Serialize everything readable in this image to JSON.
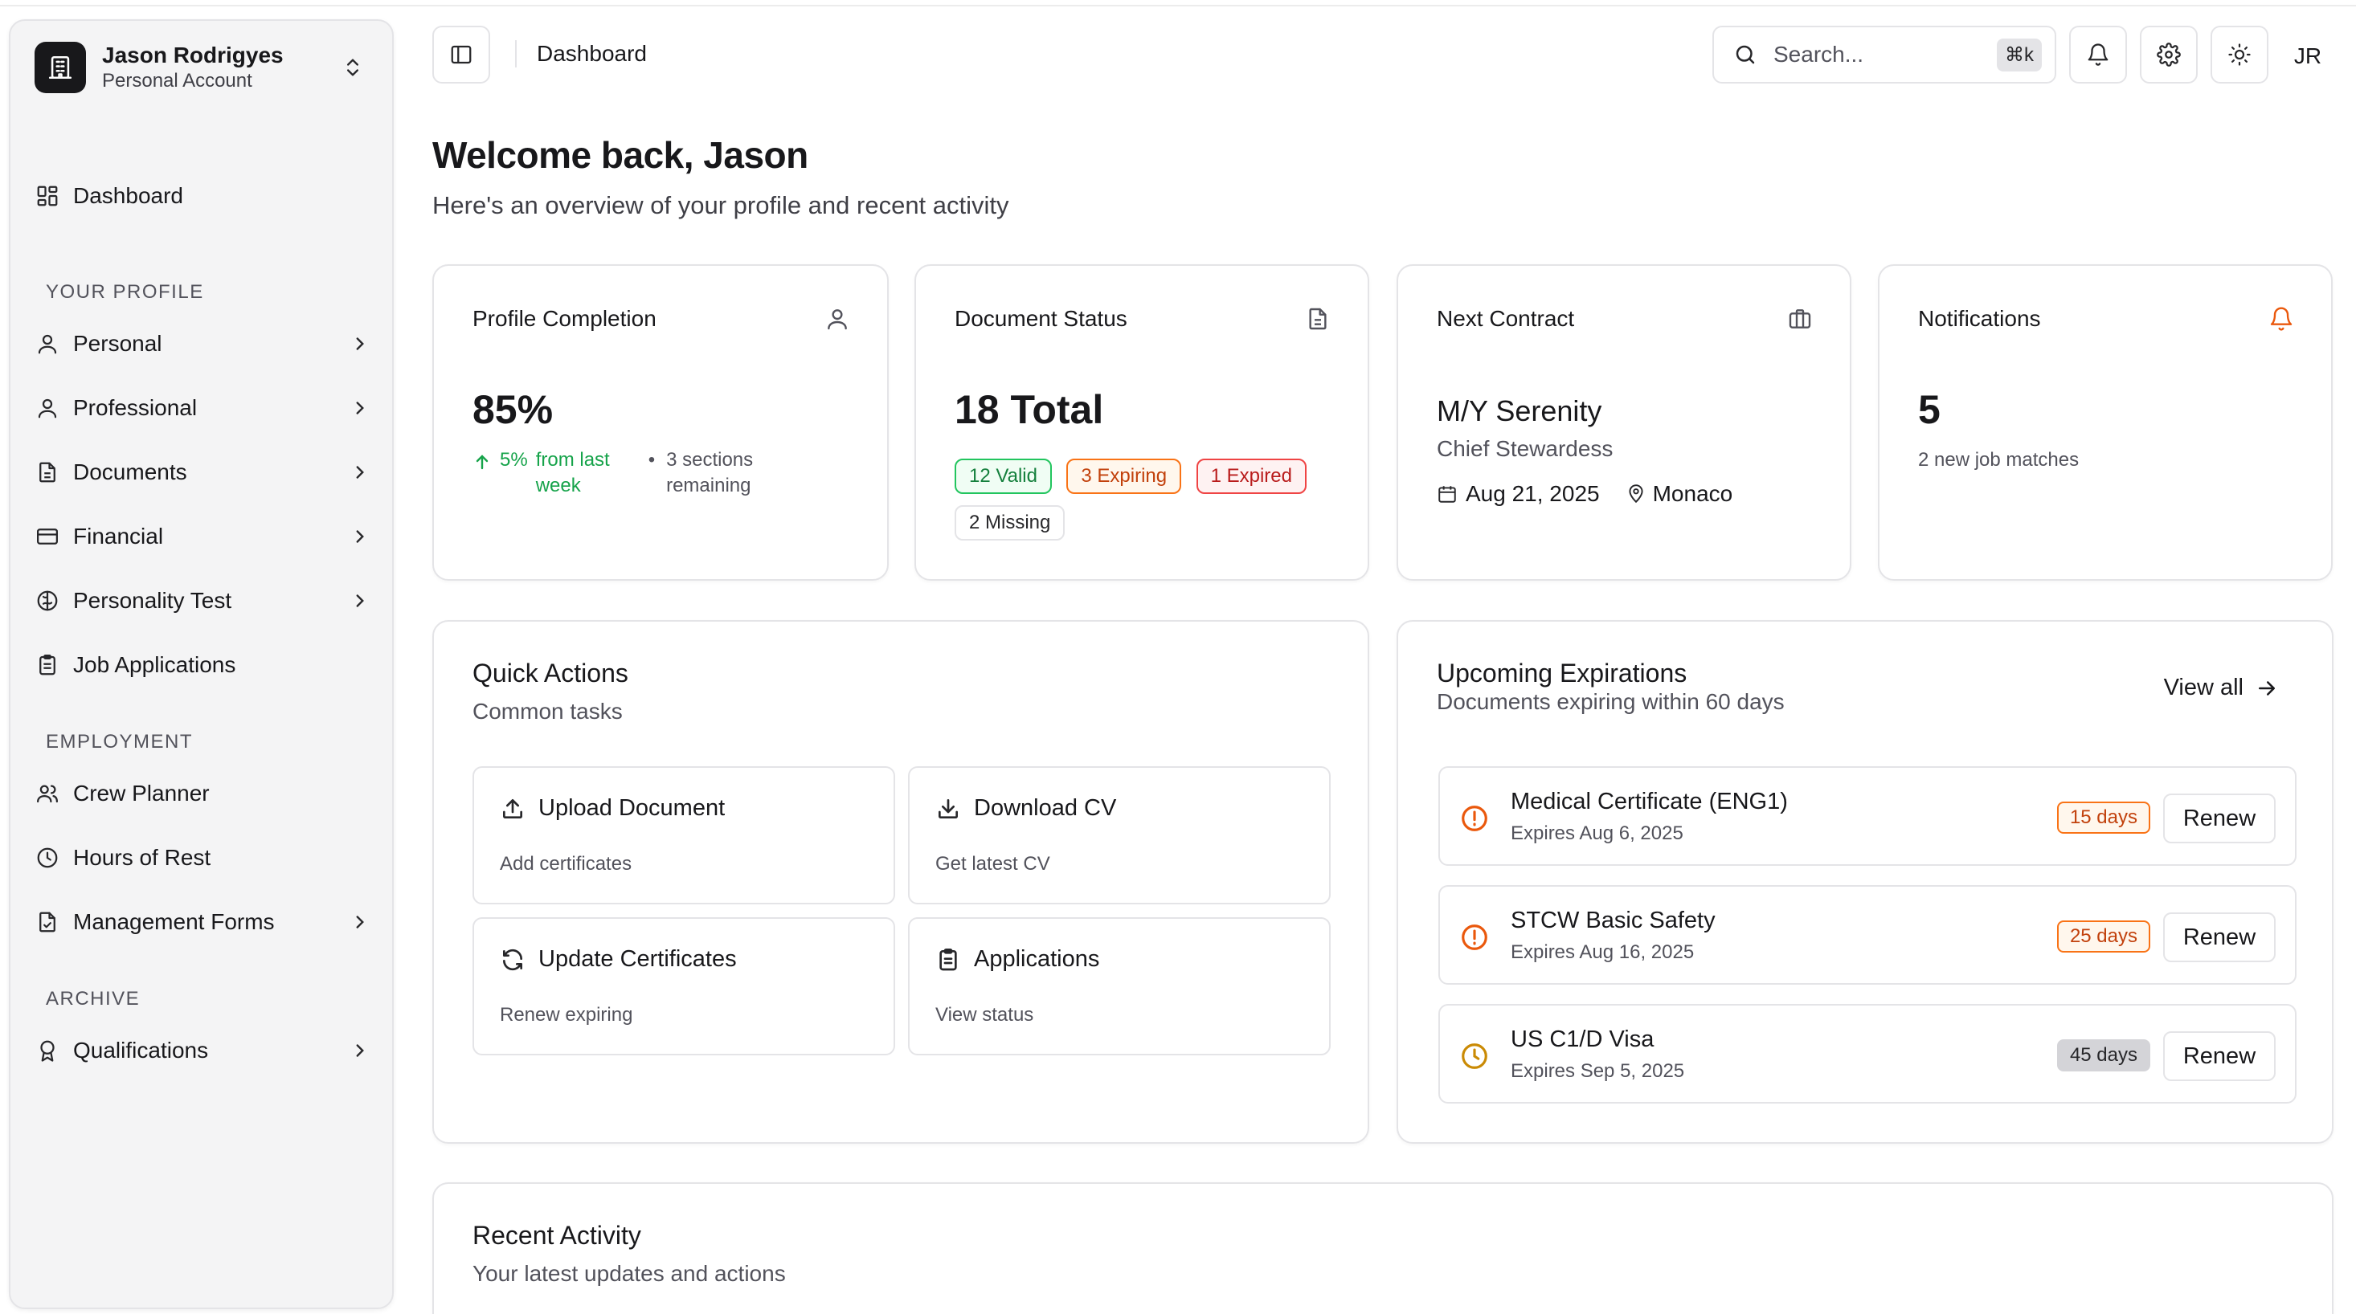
{
  "account": {
    "name": "Jason Rodrigyes",
    "subtitle": "Personal Account"
  },
  "sidebar": {
    "dashboard": "Dashboard",
    "sections": {
      "profile": "Your Profile",
      "employment": "Employment",
      "archive": "Archive"
    },
    "items": {
      "personal": "Personal",
      "professional": "Professional",
      "documents": "Documents",
      "financial": "Financial",
      "personality": "Personality Test",
      "job_applications": "Job Applications",
      "crew_planner": "Crew Planner",
      "hours_of_rest": "Hours of Rest",
      "management_forms": "Management Forms",
      "qualifications": "Qualifications"
    }
  },
  "header": {
    "breadcrumb": "Dashboard",
    "search_placeholder": "Search...",
    "shortcut": "⌘k",
    "avatar_initials": "JR"
  },
  "welcome": {
    "title": "Welcome back, Jason",
    "subtitle": "Here's an overview of your profile and recent activity"
  },
  "stats": {
    "profile": {
      "title": "Profile Completion",
      "value": "85%",
      "delta": "5%",
      "delta_label": "from last week",
      "remaining": "3 sections remaining"
    },
    "documents": {
      "title": "Document Status",
      "value": "18 Total",
      "valid": "12 Valid",
      "expiring": "3 Expiring",
      "expired": "1 Expired",
      "missing": "2 Missing"
    },
    "contract": {
      "title": "Next Contract",
      "vessel": "M/Y Serenity",
      "role": "Chief Stewardess",
      "date": "Aug 21, 2025",
      "location": "Monaco"
    },
    "notifications": {
      "title": "Notifications",
      "value": "5",
      "subtitle": "2 new job matches"
    }
  },
  "quick_actions": {
    "title": "Quick Actions",
    "subtitle": "Common tasks",
    "tiles": [
      {
        "title": "Upload Document",
        "subtitle": "Add certificates",
        "icon": "upload-icon"
      },
      {
        "title": "Download CV",
        "subtitle": "Get latest CV",
        "icon": "download-icon"
      },
      {
        "title": "Update Certificates",
        "subtitle": "Renew expiring",
        "icon": "refresh-icon"
      },
      {
        "title": "Applications",
        "subtitle": "View status",
        "icon": "clipboard-icon"
      }
    ]
  },
  "expirations": {
    "title": "Upcoming Expirations",
    "subtitle": "Documents expiring within 60 days",
    "view_all": "View all",
    "renew_label": "Renew",
    "items": [
      {
        "name": "Medical Certificate (ENG1)",
        "date": "Expires Aug 6, 2025",
        "badge": "15 days",
        "status": "urgent"
      },
      {
        "name": "STCW Basic Safety",
        "date": "Expires Aug 16, 2025",
        "badge": "25 days",
        "status": "urgent"
      },
      {
        "name": "US C1/D Visa",
        "date": "Expires Sep 5, 2025",
        "badge": "45 days",
        "status": "upcoming"
      }
    ]
  },
  "recent": {
    "title": "Recent Activity",
    "subtitle": "Your latest updates and actions"
  },
  "colors": {
    "green": "#16a34a",
    "orange": "#ea580c",
    "red": "#dc2626",
    "amber": "#ca8a04",
    "gray_badge": "#d4d4d8"
  }
}
